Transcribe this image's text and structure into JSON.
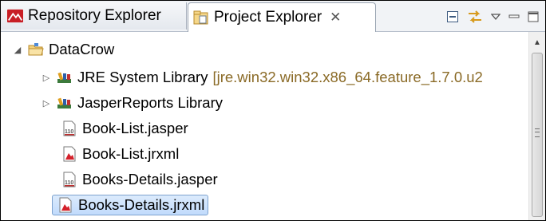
{
  "tabs": {
    "repository": {
      "label": "Repository Explorer",
      "icon": "repository-icon"
    },
    "project": {
      "label": "Project Explorer",
      "icon": "project-explorer-icon",
      "close_glyph": "✕"
    }
  },
  "toolbar": {
    "buttons": [
      "collapse-all-icon",
      "link-with-editor-icon",
      "view-menu-icon",
      "minimize-icon",
      "maximize-icon"
    ]
  },
  "tree": {
    "root": {
      "label": "DataCrow",
      "expanded": true,
      "icon": "project-folder-icon"
    },
    "items": [
      {
        "label": "JRE System Library",
        "decoration": "[jre.win32.win32.x86_64.feature_1.7.0.u2",
        "icon": "library-icon",
        "expandable": true
      },
      {
        "label": "JasperReports Library",
        "decoration": "",
        "icon": "library-icon",
        "expandable": true
      },
      {
        "label": "Book-List.jasper",
        "decoration": "",
        "icon": "jasper-file-icon",
        "expandable": false
      },
      {
        "label": "Book-List.jrxml",
        "decoration": "",
        "icon": "jrxml-file-icon",
        "expandable": false
      },
      {
        "label": "Books-Details.jasper",
        "decoration": "",
        "icon": "jasper-file-icon",
        "expandable": false
      },
      {
        "label": "Books-Details.jrxml",
        "decoration": "",
        "icon": "jrxml-file-icon",
        "expandable": false,
        "selected": true
      }
    ]
  },
  "colors": {
    "selection": "#c8defb",
    "decoration": "#8a6a26",
    "accent_red": "#d4202a",
    "folder_yellow": "#e8b84a"
  }
}
